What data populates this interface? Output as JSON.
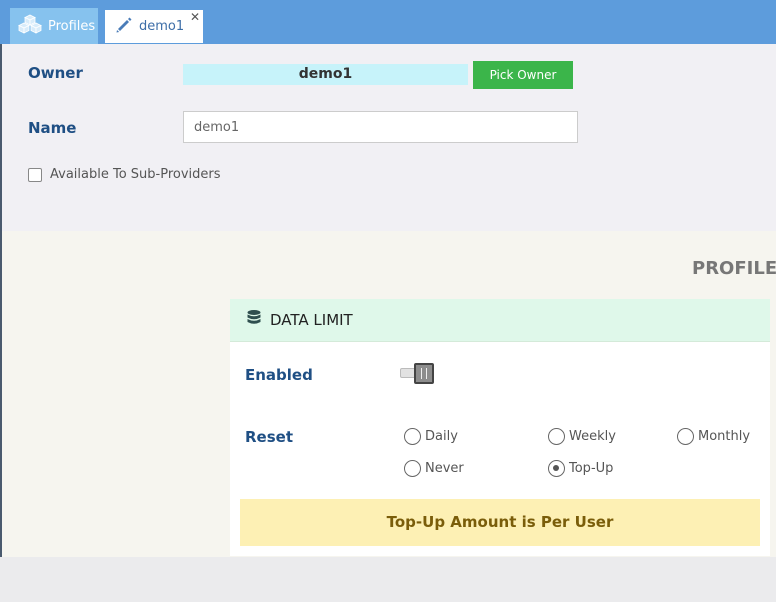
{
  "tabs": {
    "profiles_label": "Profiles",
    "demo_label": "demo1",
    "close_glyph": "✕"
  },
  "form": {
    "owner_label": "Owner",
    "owner_value": "demo1",
    "pick_owner_label": "Pick Owner",
    "name_label": "Name",
    "name_value": "demo1",
    "available_label": "Available To Sub-Providers",
    "available_checked": false
  },
  "profile_section": {
    "heading": "PROFILE"
  },
  "data_limit": {
    "title": "DATA LIMIT",
    "enabled_label": "Enabled",
    "enabled": false,
    "reset_label": "Reset",
    "reset_options": [
      "Daily",
      "Weekly",
      "Monthly",
      "Never",
      "Top-Up"
    ],
    "reset_selected": "Top-Up",
    "notice": "Top-Up Amount is Per User"
  },
  "colors": {
    "tabbar": "#5d9cdc",
    "label_blue": "#1f4f84",
    "pick_button": "#3bb54a",
    "owner_box": "#c7f3fa",
    "card_header": "#dff8ea",
    "notice_bg": "#fdf0b4",
    "notice_text": "#7a5d0a"
  }
}
